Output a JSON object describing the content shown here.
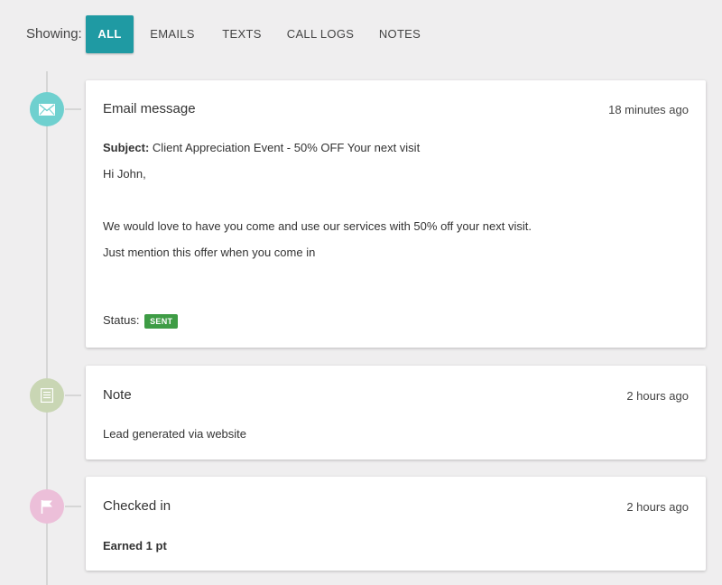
{
  "filter": {
    "label": "Showing:",
    "tabs": [
      "ALL",
      "EMAILS",
      "TEXTS",
      "CALL LOGS",
      "NOTES"
    ],
    "active": "ALL"
  },
  "colors": {
    "accent": "#1f9aa3",
    "email_marker": "#6fd0cf",
    "note_marker": "#c9d6b4",
    "checkin_marker": "#ecbfd9",
    "status_sent": "#3e9c45"
  },
  "events": [
    {
      "type": "email",
      "icon": "envelope-icon",
      "title": "Email message",
      "time": "18 minutes ago",
      "subject_label": "Subject:",
      "subject": "Client Appreciation Event - 50% OFF Your next visit",
      "greeting": "Hi John,",
      "lines": [
        "We would love to have you come and use our services with 50% off your next visit.",
        "Just mention this offer when you come in"
      ],
      "status_label": "Status:",
      "status": "SENT"
    },
    {
      "type": "note",
      "icon": "note-icon",
      "title": "Note",
      "time": "2 hours ago",
      "text": "Lead generated via website"
    },
    {
      "type": "checkin",
      "icon": "flag-icon",
      "title": "Checked in",
      "time": "2 hours ago",
      "text": "Earned 1 pt"
    }
  ]
}
